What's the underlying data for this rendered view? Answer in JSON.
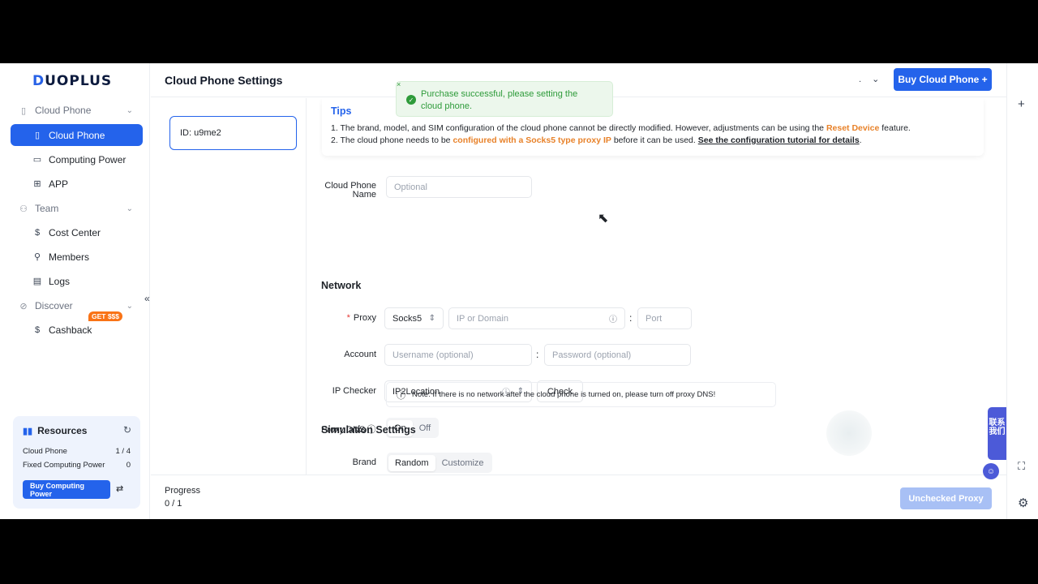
{
  "brand": {
    "logo_d": "D",
    "logo_rest": "UOPLUS"
  },
  "sidebar": {
    "groups": [
      {
        "label": "Cloud Phone",
        "icon": "phone-icon"
      },
      {
        "label": "Team",
        "icon": "users-icon"
      },
      {
        "label": "Discover",
        "icon": "compass-icon"
      }
    ],
    "items": [
      {
        "label": "Cloud Phone",
        "icon": "phone-icon",
        "active": true
      },
      {
        "label": "Computing Power",
        "icon": "monitor-icon"
      },
      {
        "label": "APP",
        "icon": "grid-icon"
      },
      {
        "label": "Cost Center",
        "icon": "dollar-icon"
      },
      {
        "label": "Members",
        "icon": "members-icon"
      },
      {
        "label": "Logs",
        "icon": "document-icon"
      },
      {
        "label": "Cashback",
        "icon": "dollar-sign-icon",
        "badge": "GET $$$"
      }
    ],
    "collapse_label": "«"
  },
  "resources": {
    "title": "Resources",
    "rows": [
      {
        "label": "Cloud Phone",
        "value": "1 / 4"
      },
      {
        "label": "Fixed Computing Power",
        "value": "0"
      }
    ],
    "buy_label": "Buy Computing Power"
  },
  "header": {
    "title": "Cloud Phone Settings",
    "selector": ".",
    "buy_button": "Buy Cloud Phone +"
  },
  "toast": {
    "message": "Purchase successful, please setting the cloud phone.",
    "close": "×"
  },
  "id_card": {
    "label": "ID: u9me2"
  },
  "tips": {
    "title": "Tips",
    "line1_a": "1. The brand, model, and SIM configuration of the cloud phone cannot be directly modified. However, adjustments can be using the ",
    "line1_hl": "Reset Device",
    "line1_b": " feature.",
    "line2_a": "2. The cloud phone needs to be ",
    "line2_hl": "configured with a Socks5 type proxy IP",
    "line2_b": " before it can be used. ",
    "line2_link": "See the configuration tutorial for details",
    "line2_c": "."
  },
  "form": {
    "name_label": "Cloud Phone Name",
    "name_placeholder": "Optional",
    "network_title": "Network",
    "proxy_label": "Proxy",
    "proxy_type": "Socks5",
    "proxy_host_placeholder": "IP or Domain",
    "proxy_port_placeholder": "Port",
    "account_label": "Account",
    "username_placeholder": "Username (optional)",
    "password_placeholder": "Password (optional)",
    "ip_checker_label": "IP Checker",
    "ip_checker_value": "IP2Location",
    "check_button": "Check",
    "dns_label": "Proxy DNS",
    "dns_on": "On",
    "dns_off": "Off",
    "dns_note": "Note: If there is no network after the cloud phone is turned on, please turn off proxy DNS!",
    "simulation_title": "Simulation Settings",
    "brand_label": "Brand",
    "brand_random": "Random",
    "brand_customize": "Customize"
  },
  "bottom": {
    "progress_label": "Progress",
    "progress_value": "0 / 1",
    "progress_fraction": 0,
    "unchecked_button": "Unchecked Proxy"
  },
  "contact": {
    "label": "联系我们"
  },
  "colors": {
    "primary": "#2463eb",
    "warning": "#e8822a",
    "success": "#2e9b3a",
    "contact": "#4c5ad8"
  }
}
